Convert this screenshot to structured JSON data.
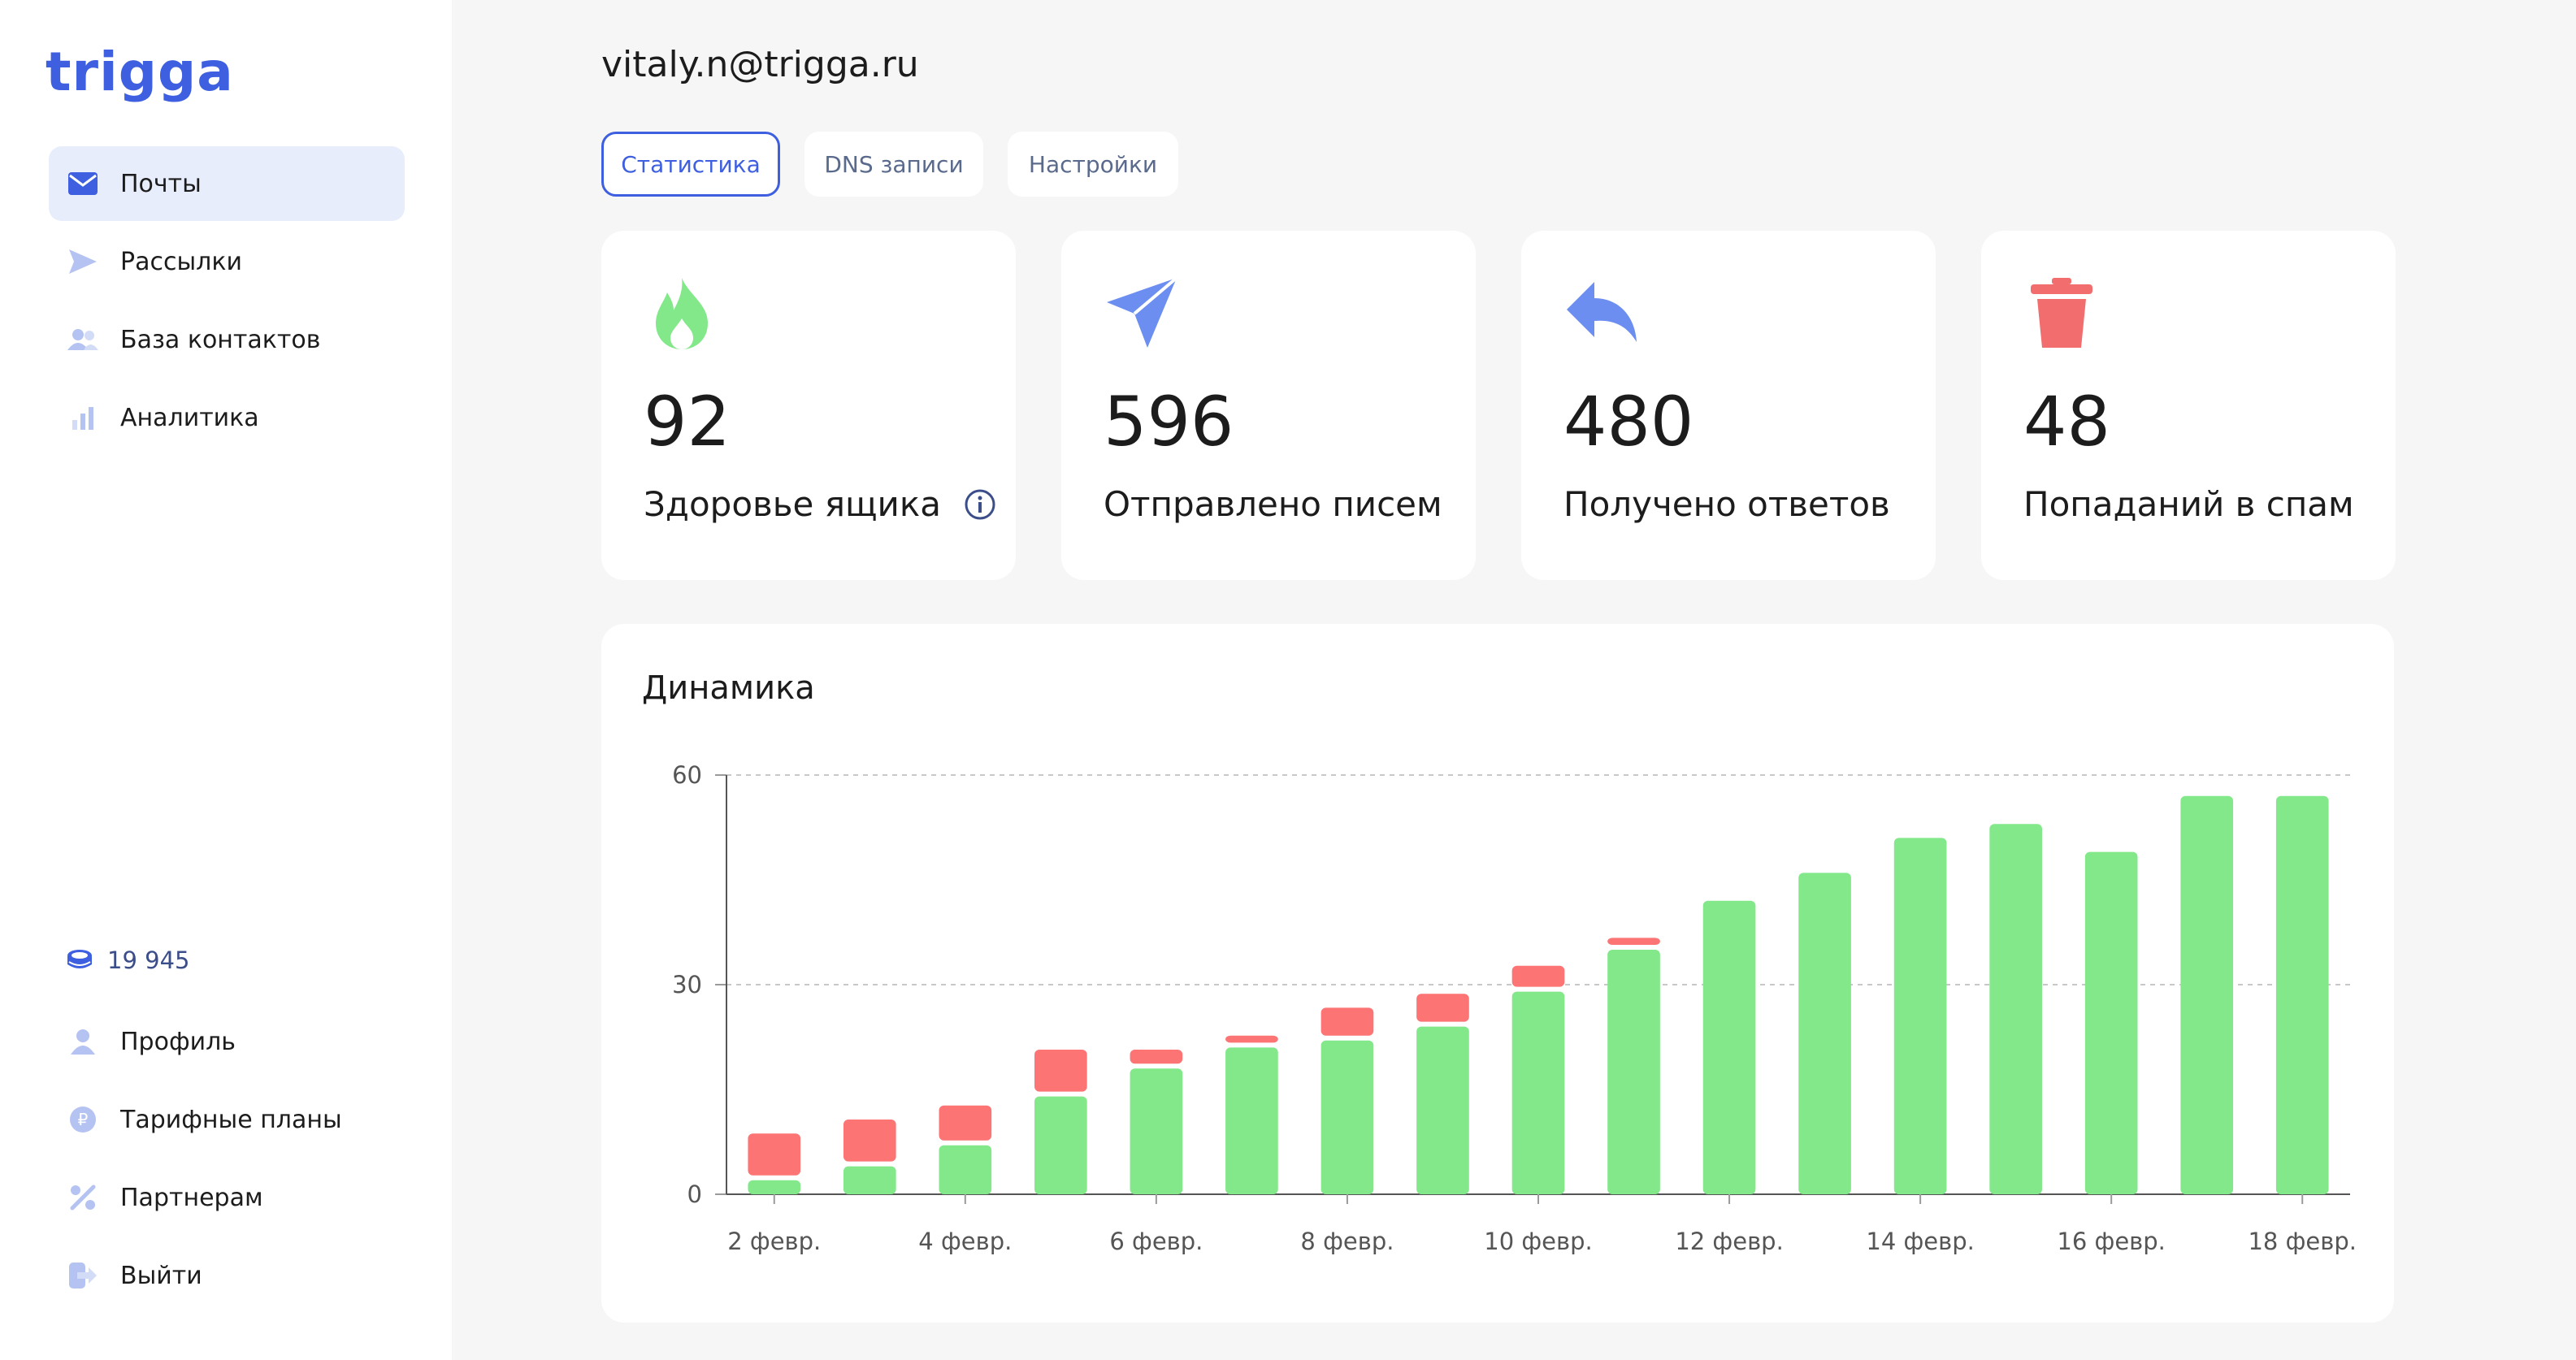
{
  "app": {
    "logo": "trigga"
  },
  "sidebar": {
    "items": [
      {
        "label": "Почты",
        "icon": "mail-icon",
        "active": true
      },
      {
        "label": "Рассылки",
        "icon": "send-icon",
        "active": false
      },
      {
        "label": "База контактов",
        "icon": "contacts-icon",
        "active": false
      },
      {
        "label": "Аналитика",
        "icon": "analytics-icon",
        "active": false
      }
    ],
    "balance": {
      "value": "19 945",
      "icon": "coins-icon"
    },
    "bottom_items": [
      {
        "label": "Профиль",
        "icon": "profile-icon"
      },
      {
        "label": "Тарифные планы",
        "icon": "ruble-icon"
      },
      {
        "label": "Партнерам",
        "icon": "percent-icon"
      },
      {
        "label": "Выйти",
        "icon": "logout-icon"
      }
    ]
  },
  "header": {
    "email": "vitaly.n@trigga.ru"
  },
  "tabs": [
    {
      "label": "Статистика",
      "active": true
    },
    {
      "label": "DNS записи",
      "active": false
    },
    {
      "label": "Настройки",
      "active": false
    }
  ],
  "stats": [
    {
      "value": "92",
      "label": "Здоровье ящика",
      "icon": "fire-icon",
      "color": "#7ee787",
      "has_info": true
    },
    {
      "value": "596",
      "label": "Отправлено писем",
      "icon": "paper-plane-icon",
      "color": "#6b8ef0",
      "has_info": false
    },
    {
      "value": "480",
      "label": "Получено ответов",
      "icon": "reply-icon",
      "color": "#6b8ef0",
      "has_info": false
    },
    {
      "value": "48",
      "label": "Попаданий в спам",
      "icon": "trash-icon",
      "color": "#f26d6d",
      "has_info": false
    }
  ],
  "colors": {
    "accent": "#3d5fe0",
    "green": "#82e889",
    "red": "#fc7474",
    "nav_active_bg": "#e8edfc"
  },
  "chart_data": {
    "title": "Динамика",
    "type": "bar",
    "stacked": true,
    "ylim": [
      0,
      60
    ],
    "yticks": [
      0,
      30,
      60
    ],
    "grid": true,
    "categories": [
      "2 февр.",
      "3 февр.",
      "4 февр.",
      "5 февр.",
      "6 февр.",
      "7 февр.",
      "8 февр.",
      "9 февр.",
      "10 февр.",
      "11 февр.",
      "12 февр.",
      "13 февр.",
      "14 февр.",
      "15 февр.",
      "16 февр.",
      "17 февр.",
      "18 февр."
    ],
    "xtick_labels": [
      "2 февр.",
      "4 февр.",
      "6 февр.",
      "8 февр.",
      "10 февр.",
      "12 февр.",
      "14 февр.",
      "16 февр.",
      "18 февр."
    ],
    "series": [
      {
        "color": "#82e889",
        "values": [
          2,
          4,
          7,
          14,
          18,
          21,
          22,
          24,
          29,
          35,
          42,
          46,
          51,
          53,
          49,
          57,
          57
        ]
      },
      {
        "color": "#fc7474",
        "values": [
          6,
          6,
          5,
          6,
          2,
          1,
          4,
          4,
          3,
          1,
          0,
          0,
          0,
          0,
          0,
          0,
          0
        ]
      }
    ]
  }
}
